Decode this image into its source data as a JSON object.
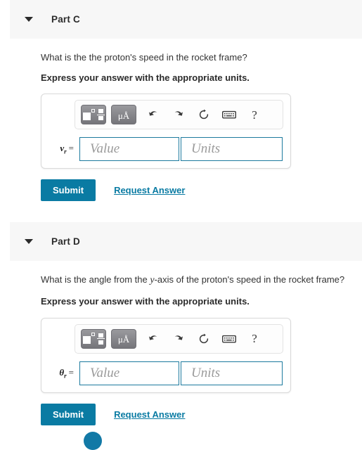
{
  "parts": [
    {
      "id": "part-c",
      "title": "Part C",
      "caret_icon": "caret-down-icon",
      "question_pre": "What is the the proton's speed in the rocket frame?",
      "question_var": "",
      "question_post": "",
      "instruction": "Express your answer with the appropriate units.",
      "toolbar": {
        "template_button": "template-icon",
        "units_button": "μÅ",
        "undo_button": "undo-icon",
        "redo_button": "redo-icon",
        "reset_button": "reset-icon",
        "keyboard_button": "keyboard-icon",
        "help_button": "?"
      },
      "variable": "v",
      "subscript": "r",
      "equals": "=",
      "value_placeholder": "Value",
      "units_placeholder": "Units",
      "value_current": "",
      "units_current": "",
      "submit_label": "Submit",
      "request_answer_label": "Request Answer"
    },
    {
      "id": "part-d",
      "title": "Part D",
      "caret_icon": "caret-down-icon",
      "question_pre": "What is the angle from the ",
      "question_var": "y",
      "question_post": "-axis of the proton's speed in the rocket frame?",
      "instruction": "Express your answer with the appropriate units.",
      "toolbar": {
        "template_button": "template-icon",
        "units_button": "μÅ",
        "undo_button": "undo-icon",
        "redo_button": "redo-icon",
        "reset_button": "reset-icon",
        "keyboard_button": "keyboard-icon",
        "help_button": "?"
      },
      "variable": "θ",
      "subscript": "r",
      "equals": "=",
      "value_placeholder": "Value",
      "units_placeholder": "Units",
      "value_current": "",
      "units_current": "",
      "submit_label": "Submit",
      "request_answer_label": "Request Answer"
    }
  ],
  "colors": {
    "accent": "#0a7ba3",
    "field_border": "#1c7a9e",
    "header_bg": "#f7f7f7",
    "text": "#333333"
  }
}
